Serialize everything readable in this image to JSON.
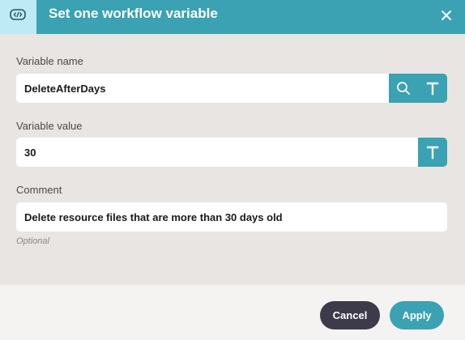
{
  "dialog": {
    "title": "Set one workflow variable",
    "header_icon": "variable-icon",
    "close_icon": "close-icon"
  },
  "fields": {
    "variable_name": {
      "label": "Variable name",
      "value": "DeleteAfterDays"
    },
    "variable_value": {
      "label": "Variable value",
      "value": "30"
    },
    "comment": {
      "label": "Comment",
      "value": "Delete resource files that are more than 30 days old",
      "hint": "Optional"
    }
  },
  "footer": {
    "cancel_label": "Cancel",
    "apply_label": "Apply"
  },
  "colors": {
    "accent": "#3aa2b3",
    "header_icon_bg": "#bdeaf5",
    "body_bg": "#e8e5e2",
    "footer_bg": "#f4f3f1",
    "cancel_bg": "#3d3a4a"
  }
}
